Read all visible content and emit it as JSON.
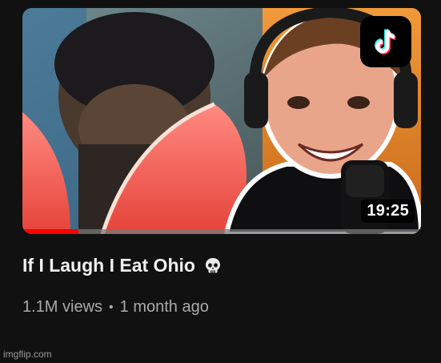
{
  "video": {
    "title": "If I Laugh I Eat Ohio",
    "title_emoji": "skull-icon",
    "views": "1.1M views",
    "separator": "•",
    "age": "1 month ago",
    "duration": "19:25",
    "watch_progress": 0.14,
    "platform_badge": "tiktok-icon"
  },
  "colors": {
    "background": "#111111",
    "progress": "#ff0000",
    "title": "#f1f1f1",
    "meta": "#aaaaaa",
    "accent_orange": "#e07a1f"
  },
  "watermark": "imgflip.com"
}
